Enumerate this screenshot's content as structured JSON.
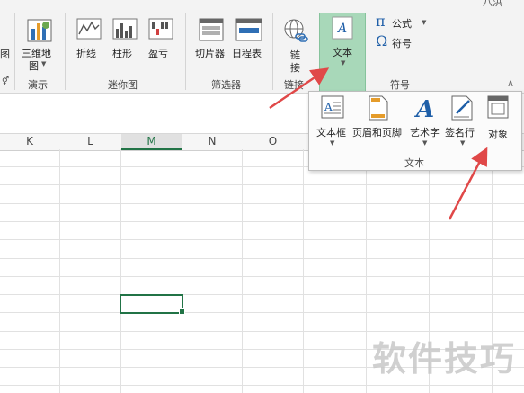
{
  "ribbon": {
    "top_right_fragment": "八洪",
    "partial_left": "图",
    "partial_left_group": "⚥",
    "map3d": {
      "label_line1": "三维地",
      "label_line2": "图"
    },
    "demo_group": "演示",
    "sparklines": {
      "line": "折线",
      "column": "柱形",
      "winloss": "盈亏",
      "group": "迷你图"
    },
    "filters": {
      "slicer": "切片器",
      "timeline": "日程表",
      "group": "筛选器"
    },
    "links": {
      "link_line1": "链",
      "link_line2": "接",
      "group": "链接"
    },
    "text": {
      "label": "文本"
    },
    "symbols": {
      "equation": "公式",
      "symbol": "符号",
      "group": "符号",
      "pi": "π",
      "omega": "Ω"
    }
  },
  "text_dropdown": {
    "items": [
      {
        "label": "文本框",
        "icon": "textbox-icon"
      },
      {
        "label": "页眉和页脚",
        "icon": "header-footer-icon"
      },
      {
        "label": "艺术字",
        "icon": "wordart-icon"
      },
      {
        "label": "签名行",
        "icon": "signature-line-icon"
      },
      {
        "label": "对象",
        "icon": "object-icon"
      }
    ],
    "group": "文本"
  },
  "columns": [
    "K",
    "L",
    "M",
    "N",
    "O"
  ],
  "watermark": "软件技巧",
  "colors": {
    "selected_tab": "#a8d8b9",
    "cell_border": "#217346",
    "arrow": "#e04848"
  }
}
